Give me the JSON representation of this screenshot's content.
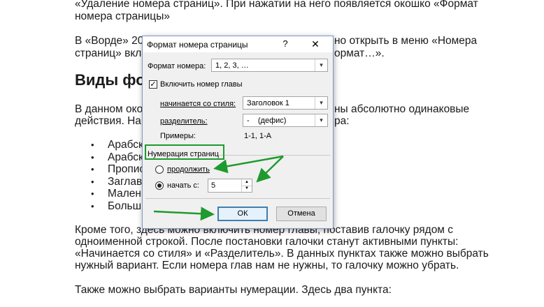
{
  "article": {
    "line1": "«Удаление номера страниц». При нажатии на него появляется окошко «Формат",
    "line2": "номера страницы»",
    "line3a": "В «Ворде» 20",
    "line3b": "но открыть в меню «Номера",
    "line4a": "страниц» вкла",
    "line4b": "ормат…».",
    "heading": "Виды фо",
    "line5a": "В данном око",
    "line5b": "ны абсолютно одинаковые",
    "line6a": "действия. Нап",
    "line6b": "ра:",
    "bullets": [
      "Арабск",
      "Арабск",
      "Пропис",
      "Заглав",
      "Малень",
      "Больш"
    ],
    "line7": "Кроме того, здесь можно включить номер главы, поставив галочку рядом с",
    "line8": "одноименной строкой. После постановки галочки станут активными пункты:",
    "line9": "«Начинается со стиля» и «Разделитель». В данных пунктах также можно выбрать",
    "line10": "нужный вариант. Если номера глав нам не нужны, то галочку можно убрать.",
    "line11": "Также можно выбрать варианты нумерации. Здесь два пункта:"
  },
  "dialog": {
    "title": "Формат номера страницы",
    "help": "?",
    "close": "✕",
    "format_label": "Формат номера:",
    "format_value": "1, 2, 3, …",
    "include_chapter": "Включить номер главы",
    "include_checked": "✓",
    "starts_with_label": "начинается со стиля:",
    "starts_with_value": "Заголовок 1",
    "separator_label": "разделитель:",
    "separator_value": "-    (дефис)",
    "examples_label": "Примеры:",
    "examples_value": "1-1, 1-A",
    "numbering_group": "Нумерация страниц",
    "continue_label": "продолжить",
    "start_at_label": "начать с:",
    "start_at_value": "5",
    "ok": "ОК",
    "cancel": "Отмена"
  },
  "icons": {
    "combo_arrow": "▾",
    "spin_up": "▲",
    "spin_down": "▼"
  },
  "colors": {
    "highlight": "#1e9a2e",
    "ok_border": "#3c7fb1"
  }
}
